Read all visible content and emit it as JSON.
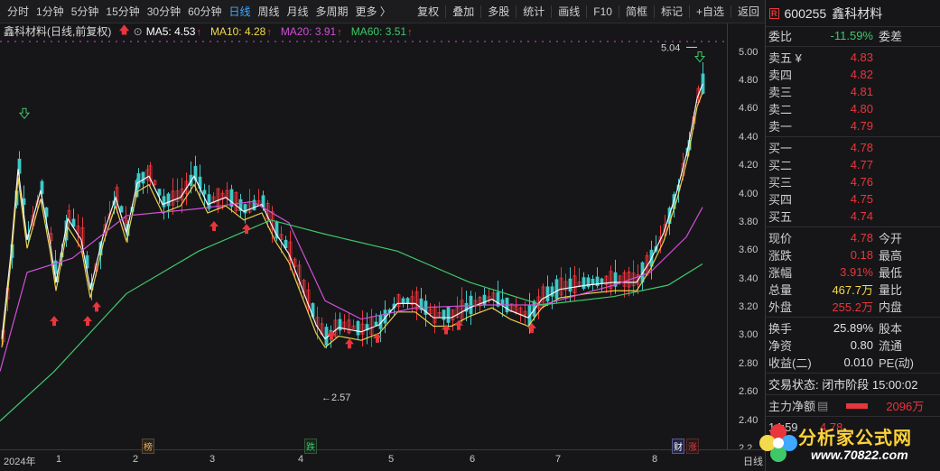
{
  "toolbar": {
    "left": [
      "分时",
      "1分钟",
      "5分钟",
      "15分钟",
      "30分钟",
      "60分钟",
      "日线",
      "周线",
      "月线",
      "多周期",
      "更多 〉"
    ],
    "active_index": 6,
    "right": [
      "复权",
      "叠加",
      "多股",
      "统计",
      "画线",
      "F10",
      "简框",
      "标记",
      "+自选",
      "返回"
    ]
  },
  "info": {
    "title": "鑫科材料(日线,前复权)",
    "ma5": "MA5: 4.53",
    "ma10": "MA10: 4.28",
    "ma20": "MA20: 3.91",
    "ma60": "MA60: 3.51",
    "up": "↑"
  },
  "colors": {
    "up": "#e8363c",
    "down": "#3fc8c8",
    "ma5": "#ffffff",
    "ma10": "#f2d94e",
    "ma20": "#d04fd6",
    "ma60": "#3fc86a",
    "grid": "#5a2020"
  },
  "chart_data": {
    "type": "candlestick",
    "title": "鑫科材料(日线,前复权)",
    "y_ticks": [
      "5.00",
      "4.80",
      "4.60",
      "4.40",
      "4.20",
      "4.00",
      "3.80",
      "3.60",
      "3.40",
      "3.20",
      "3.00",
      "2.80",
      "2.60",
      "2.40",
      "2.2"
    ],
    "ylim": [
      2.2,
      5.1
    ],
    "x_labels": [
      "2024年",
      "1",
      "2",
      "3",
      "4",
      "5",
      "6",
      "7",
      "8"
    ],
    "annotations": [
      "5.04",
      "2.57"
    ],
    "events": [
      "榜",
      "跌",
      "财",
      "涨"
    ],
    "period": "日线",
    "series": [
      {
        "name": "MA5",
        "last": 4.53
      },
      {
        "name": "MA10",
        "last": 4.28
      },
      {
        "name": "MA20",
        "last": 3.91
      },
      {
        "name": "MA60",
        "last": 3.51
      }
    ]
  },
  "panel": {
    "r": "R",
    "code": "600255",
    "name": "鑫科材料",
    "weibi_label": "委比",
    "weibi_value": "-11.59%",
    "weicha_label": "委差",
    "sells": [
      {
        "label": "卖五 ¥",
        "price": "4.83"
      },
      {
        "label": "卖四",
        "price": "4.82"
      },
      {
        "label": "卖三",
        "price": "4.81"
      },
      {
        "label": "卖二",
        "price": "4.80"
      },
      {
        "label": "卖一",
        "price": "4.79"
      }
    ],
    "buys": [
      {
        "label": "买一",
        "price": "4.78"
      },
      {
        "label": "买二",
        "price": "4.77"
      },
      {
        "label": "买三",
        "price": "4.76"
      },
      {
        "label": "买四",
        "price": "4.75"
      },
      {
        "label": "买五",
        "price": "4.74"
      }
    ],
    "stats": [
      {
        "l": "现价",
        "v": "4.78",
        "l2": "今开"
      },
      {
        "l": "涨跌",
        "v": "0.18",
        "l2": "最高"
      },
      {
        "l": "涨幅",
        "v": "3.91%",
        "l2": "最低"
      },
      {
        "l": "总量",
        "v": "467.7万",
        "l2": "量比"
      },
      {
        "l": "外盘",
        "v": "255.2万",
        "l2": "内盘"
      }
    ],
    "stats2": [
      {
        "l": "换手",
        "v": "25.89%",
        "l2": "股本"
      },
      {
        "l": "净资",
        "v": "0.80",
        "l2": "流通"
      },
      {
        "l": "收益(二)",
        "v": "0.010",
        "l2": "PE(动)"
      }
    ],
    "status": "交易状态: 闭市阶段 15:00:02",
    "zljr_label": "主力净额",
    "zljr_value": "2096万",
    "time": "14:59",
    "time_price": "4.78"
  },
  "logo": {
    "title": "分析家公式网",
    "url": "www.70822.com"
  }
}
